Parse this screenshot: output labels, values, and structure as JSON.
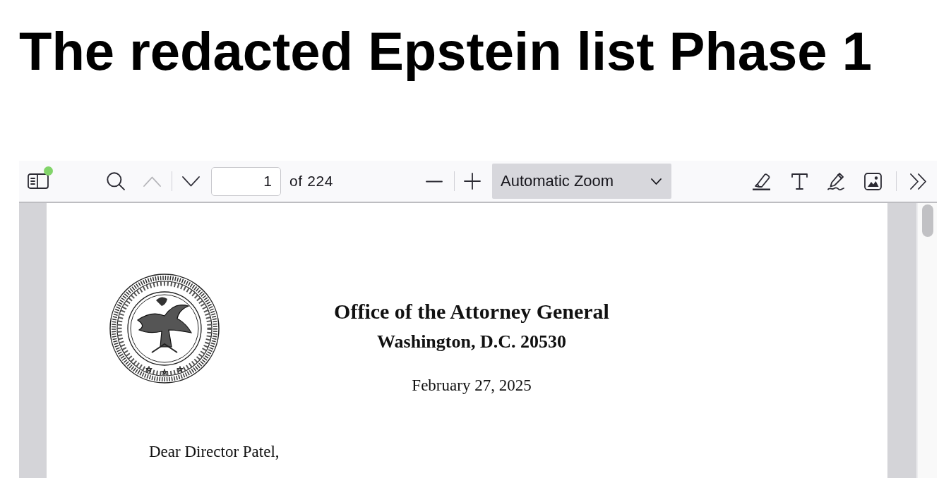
{
  "heading": "The redacted Epstein list Phase 1",
  "viewer": {
    "toolbar": {
      "sidebar_toggle": {
        "notification": true
      },
      "navigation": [
        {
          "kind": "find",
          "disabled": false
        },
        {
          "kind": "previous",
          "disabled": true
        },
        {
          "kind": "next",
          "disabled": false
        }
      ],
      "page_number": {
        "value": "1"
      },
      "page_count": "of 224",
      "zoom_buttons": [
        {
          "kind": "zoom-out",
          "disabled": false
        },
        {
          "kind": "zoom-in",
          "disabled": false
        }
      ],
      "zoom_select": {
        "value": "Automatic Zoom"
      },
      "tools": [
        {
          "kind": "highlight"
        },
        {
          "kind": "text"
        },
        {
          "kind": "draw"
        },
        {
          "kind": "image"
        },
        {
          "kind": "more"
        }
      ]
    },
    "document": {
      "letterhead": [
        "Office of the Attorney General",
        "Washington, D.C. 20530"
      ],
      "date": "February 27, 2025",
      "salutation": "Dear Director Patel,"
    }
  }
}
